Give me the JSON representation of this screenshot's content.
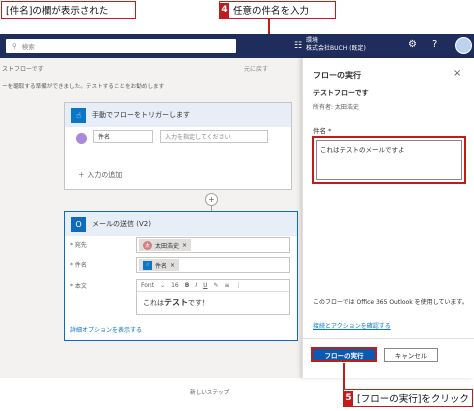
{
  "callouts": {
    "top_left": "[件名]の欄が表示された",
    "step4_num": "4",
    "step4_text": "任意の件名を入力",
    "step5_num": "5",
    "step5_text": "[フローの実行]をクリック"
  },
  "topbar": {
    "search_placeholder": "検索",
    "env_label": "環境",
    "env_name": "株式会社BUCH (既定)",
    "icons": [
      "search-icon",
      "environment-icon",
      "gear-icon",
      "help-icon",
      "avatar"
    ]
  },
  "editor": {
    "breadcrumb": "ストフローです",
    "undo": "元に戻す",
    "warning": "ーを聴取する準備ができました。テストすることをお勧めします",
    "trigger": {
      "title": "手動でフローをトリガーします",
      "input_name": "件名",
      "input_placeholder": "入力を指定してください",
      "add_input": "＋ 入力の追加"
    },
    "action": {
      "title": "メールの送信 (V2)",
      "to_label": "* 宛先",
      "to_chip": "太田浩史",
      "to_chip_initials": "太",
      "subject_label": "* 件名",
      "subject_chip": "件名",
      "body_label": "* 本文",
      "font": "Font",
      "font_size": "16",
      "body_text": "これは",
      "body_strong": "テスト",
      "body_tail": "です！",
      "advanced": "詳細オプションを表示する"
    },
    "bottom_text": "新しいステップ"
  },
  "panel": {
    "title": "フローの実行",
    "flow_name": "テストフローです",
    "owner": "所有者: 太田浩史",
    "field_label": "件名 *",
    "field_value": "これはテストのメールですよ",
    "note": "このフローでは Office 365 Outlook を使用しています。",
    "link": "接続とアクションを確認する",
    "run_button": "フローの実行",
    "cancel_button": "キャンセル"
  }
}
